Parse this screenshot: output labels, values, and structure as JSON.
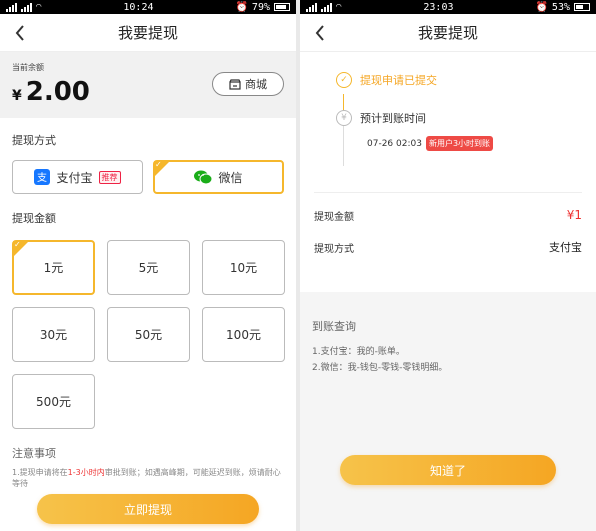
{
  "left": {
    "status": {
      "left_text": "",
      "time": "10:24",
      "battery": "79%",
      "battery_level": 0.79
    },
    "nav": {
      "title": "我要提现"
    },
    "balance": {
      "label": "当前余额",
      "currency": "¥",
      "amount": "2.00",
      "mall_label": "商城"
    },
    "method_title": "提现方式",
    "methods": [
      {
        "label": "支付宝",
        "tag": "推荐",
        "selected": false
      },
      {
        "label": "微信",
        "selected": true
      }
    ],
    "amount_title": "提现金额",
    "amounts": [
      "1元",
      "5元",
      "10元",
      "30元",
      "50元",
      "100元",
      "500元"
    ],
    "selected_amount_index": 0,
    "notice": {
      "title": "注意事项",
      "prefix": "1.提现申请将在",
      "highlight": "1-3小时内",
      "suffix": "审批到账；如遇高峰期，可能延迟到账，",
      "tail": "烦请耐心等待"
    },
    "submit_label": "立即提现"
  },
  "right": {
    "status": {
      "time": "23:03",
      "battery": "53%",
      "battery_level": 0.53
    },
    "nav": {
      "title": "我要提现"
    },
    "step1": "提现申请已提交",
    "step2": "预计到账时间",
    "eta_time": "07-26 02:03",
    "eta_badge": "新用户3小时到账",
    "amount_label": "提现金额",
    "amount_value": "¥1",
    "method_label": "提现方式",
    "method_value": "支付宝",
    "query_title": "到账查询",
    "query_lines": [
      "1.支付宝：我的-账单。",
      "2.微信：我-钱包-零钱-零钱明细。"
    ],
    "confirm_label": "知道了"
  },
  "colors": {
    "accent": "#f5b72c",
    "red": "#ee4a45",
    "alipay": "#1677ff",
    "wechat": "#1aad19"
  }
}
